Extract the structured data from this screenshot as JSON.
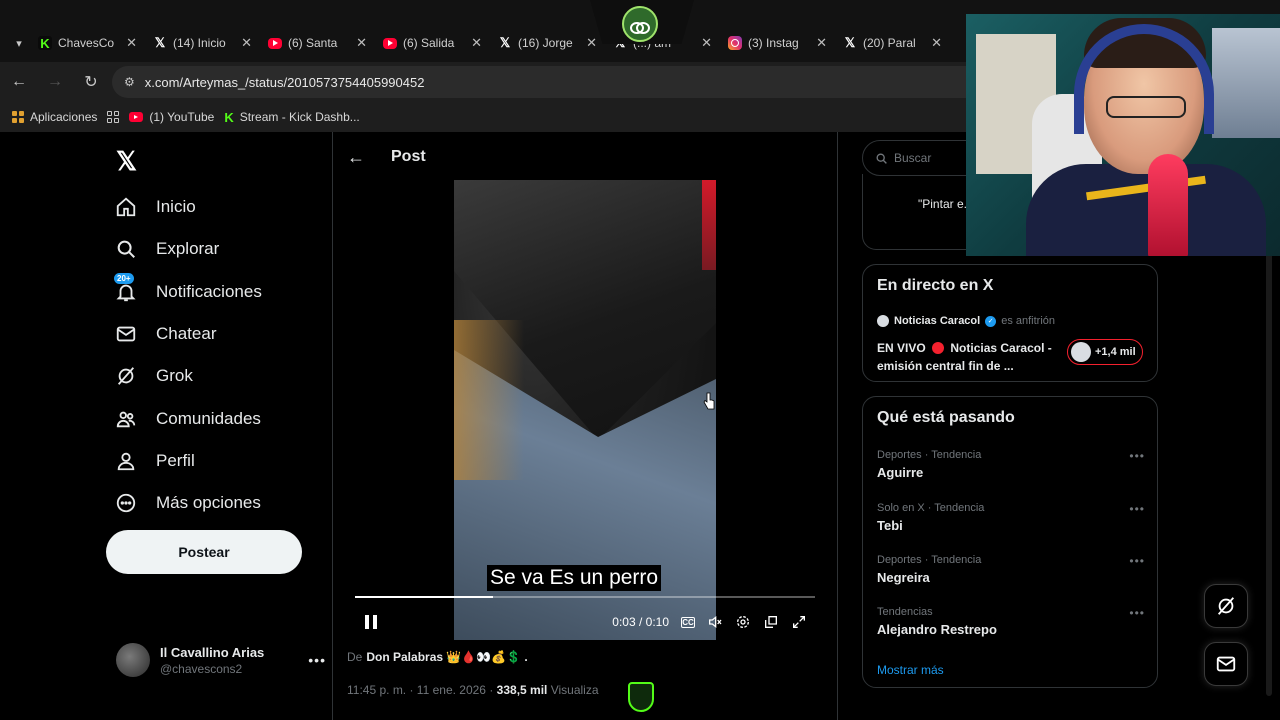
{
  "tabs": [
    {
      "icon": "kick",
      "title": "ChavesCo"
    },
    {
      "icon": "x",
      "title": "(14) Inicio"
    },
    {
      "icon": "youtube",
      "title": "(6) Santa"
    },
    {
      "icon": "youtube",
      "title": "(6) Salida"
    },
    {
      "icon": "x",
      "title": "(16) Jorge"
    },
    {
      "icon": "x",
      "title": "(...) am"
    },
    {
      "icon": "instagram",
      "title": "(3) Instag"
    },
    {
      "icon": "x",
      "title": "(20) Paral"
    }
  ],
  "address": {
    "url": "x.com/Arteymas_/status/2010573754405990452"
  },
  "bookmarks": [
    {
      "label": "Aplicaciones"
    },
    {
      "label": "(1) YouTube"
    },
    {
      "label": "Stream - Kick Dashb..."
    }
  ],
  "sidebar": {
    "logo": "𝕏",
    "items": [
      {
        "label": "Inicio",
        "icon": "home-icon"
      },
      {
        "label": "Explorar",
        "icon": "search-icon"
      },
      {
        "label": "Notificaciones",
        "icon": "bell-icon",
        "badge": "20+"
      },
      {
        "label": "Chatear",
        "icon": "mail-icon"
      },
      {
        "label": "Grok",
        "icon": "grok-icon"
      },
      {
        "label": "Comunidades",
        "icon": "people-icon"
      },
      {
        "label": "Perfil",
        "icon": "person-icon"
      },
      {
        "label": "Más opciones",
        "icon": "more-circle-icon"
      }
    ],
    "post_button": "Postear",
    "account": {
      "name": "Il Cavallino Arias",
      "handle": "@chavescons2"
    }
  },
  "main": {
    "title": "Post",
    "video": {
      "subtitle": "Se va Es un perro",
      "time": "0:03 / 0:10",
      "progress": 0.3,
      "cc_label": "CC"
    },
    "author_prefix": "De",
    "author_name": "Don Palabras 👑🩸👀💰💲 .",
    "timestamp": "11:45 p. m. · 11 ene. 2026 ·",
    "views_count": "338,5 mil",
    "views_label": "Visualiza"
  },
  "right": {
    "search_placeholder": "Buscar",
    "peek_text": "\"Pintar e... artista pi... Pollock.",
    "live": {
      "title": "En directo en X",
      "host": "Noticias Caracol",
      "host_role": "es anfitrión",
      "text_prefix": "EN VIVO",
      "text_rest": "Noticias Caracol - emisión central fin de ...",
      "listeners": "+1,4 mil"
    },
    "trends_title": "Qué está pasando",
    "trends": [
      {
        "context": "Deportes · Tendencia",
        "name": "Aguirre"
      },
      {
        "context": "Solo en X · Tendencia",
        "name": "Tebi"
      },
      {
        "context": "Deportes · Tendencia",
        "name": "Negreira"
      },
      {
        "context": "Tendencias",
        "name": "Alejandro Restrepo"
      }
    ],
    "show_more": "Mostrar más"
  },
  "colors": {
    "accent": "#1d9bf0",
    "kick_green": "#53fc18",
    "live_red": "#f4212e"
  }
}
